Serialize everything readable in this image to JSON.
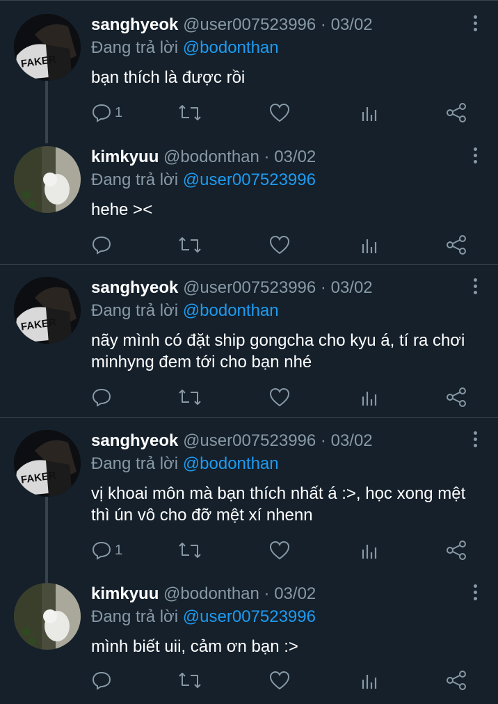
{
  "tweets": [
    {
      "name": "sanghyeok",
      "handle": "@user007523996",
      "date": "03/02",
      "reply_prefix": "Đang trả lời",
      "reply_to": "@bodonthan",
      "text": "bạn thích là được rồi",
      "reply_count": "1",
      "avatar": "faker-jersey-avatar"
    },
    {
      "name": "kimkyuu",
      "handle": "@bodonthan",
      "date": "03/02",
      "reply_prefix": "Đang trả lời",
      "reply_to": "@user007523996",
      "text": "hehe ><",
      "reply_count": "",
      "avatar": "white-cat-avatar"
    },
    {
      "name": "sanghyeok",
      "handle": "@user007523996",
      "date": "03/02",
      "reply_prefix": "Đang trả lời",
      "reply_to": "@bodonthan",
      "text": "nãy mình có đặt ship gongcha cho kyu á, tí ra chơi minhyng đem tới cho bạn nhé",
      "reply_count": "",
      "avatar": "faker-jersey-avatar"
    },
    {
      "name": "sanghyeok",
      "handle": "@user007523996",
      "date": "03/02",
      "reply_prefix": "Đang trả lời",
      "reply_to": "@bodonthan",
      "text": "vị khoai môn mà bạn thích nhất á :>, học xong mệt thì ún vô cho đỡ mệt xí nhenn",
      "reply_count": "1",
      "avatar": "faker-jersey-avatar"
    },
    {
      "name": "kimkyuu",
      "handle": "@bodonthan",
      "date": "03/02",
      "reply_prefix": "Đang trả lời",
      "reply_to": "@user007523996",
      "text": "mình biết uii, cảm ơn bạn :>",
      "reply_count": "",
      "avatar": "white-cat-avatar"
    }
  ],
  "separator": "·",
  "jersey_text": "FAKER",
  "icons": [
    "reply-icon",
    "retweet-icon",
    "like-icon",
    "analytics-icon",
    "share-icon",
    "more-options-icon"
  ],
  "colors": {
    "background": "#15202b",
    "muted": "#8899a6",
    "mention": "#1d9bf0",
    "divider": "#38444d"
  }
}
